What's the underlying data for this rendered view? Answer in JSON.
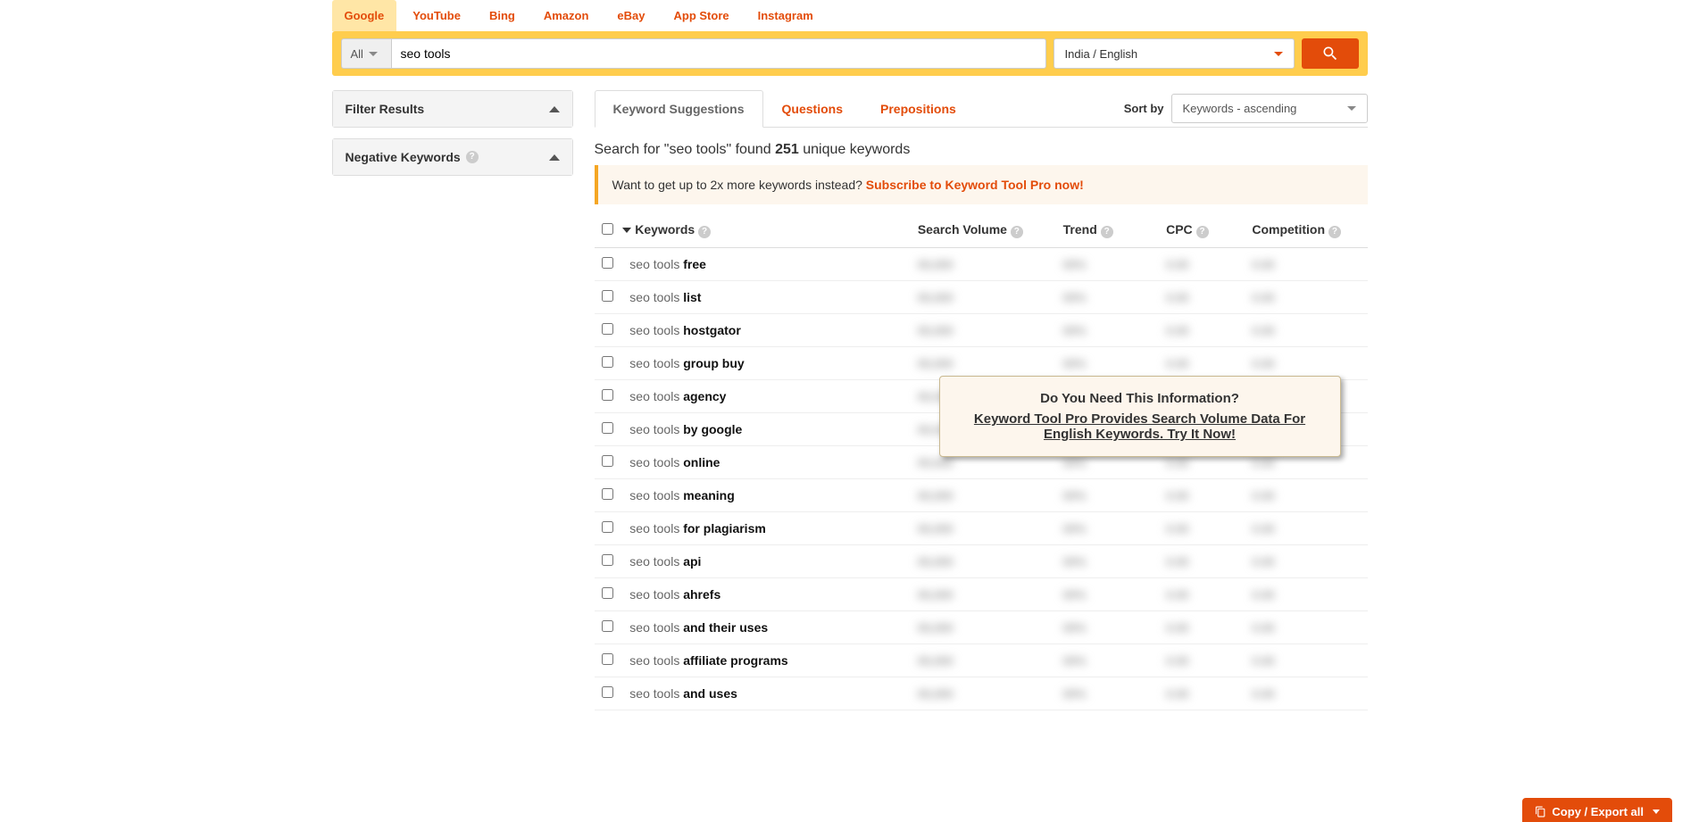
{
  "source_tabs": [
    "Google",
    "YouTube",
    "Bing",
    "Amazon",
    "eBay",
    "App Store",
    "Instagram"
  ],
  "active_source": "Google",
  "search": {
    "category": "All",
    "query": "seo tools",
    "locale": "India / English"
  },
  "sidebar": {
    "filter_title": "Filter Results",
    "negative_title": "Negative Keywords"
  },
  "content_tabs": [
    "Keyword Suggestions",
    "Questions",
    "Prepositions"
  ],
  "active_content_tab": "Keyword Suggestions",
  "sort": {
    "label": "Sort by",
    "value": "Keywords - ascending"
  },
  "results": {
    "prefix": "Search for \"seo tools\" found ",
    "count": "251",
    "suffix": " unique keywords"
  },
  "promo": {
    "text": "Want to get up to 2x more keywords instead? ",
    "link": "Subscribe to Keyword Tool Pro now!"
  },
  "table": {
    "headers": {
      "keywords": "Keywords",
      "search_volume": "Search Volume",
      "trend": "Trend",
      "cpc": "CPC",
      "competition": "Competition"
    },
    "base": "seo tools",
    "rows": [
      {
        "suffix": "free"
      },
      {
        "suffix": "list"
      },
      {
        "suffix": "hostgator"
      },
      {
        "suffix": "group buy"
      },
      {
        "suffix": "agency"
      },
      {
        "suffix": "by google"
      },
      {
        "suffix": "online"
      },
      {
        "suffix": "meaning"
      },
      {
        "suffix": "for plagiarism"
      },
      {
        "suffix": "api"
      },
      {
        "suffix": "ahrefs"
      },
      {
        "suffix": "and their uses"
      },
      {
        "suffix": "affiliate programs"
      },
      {
        "suffix": "and uses"
      }
    ],
    "placeholders": {
      "sv": "00,000",
      "trend": "00%",
      "cpc": "0.00",
      "comp": "0.00"
    }
  },
  "popup": {
    "line1": "Do You Need This Information?",
    "line2a": "Keyword Tool Pro Provides Search Volume Data For English Keywords",
    "line2b": ". Try It Now!"
  },
  "export": {
    "label": "Copy / Export all"
  }
}
